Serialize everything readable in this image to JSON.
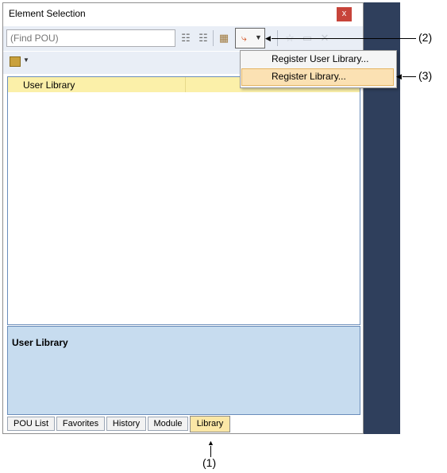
{
  "window": {
    "title": "Element Selection",
    "close_label": "x"
  },
  "search": {
    "placeholder": "(Find POU)"
  },
  "toolbar": {
    "find_next_icon": "binoculars-icon",
    "find_prev_icon": "binoculars-icon",
    "register_icon": "register-library-icon"
  },
  "menu": {
    "items": [
      "Register User Library...",
      "Register Library..."
    ]
  },
  "list": {
    "rows": [
      "User Library"
    ]
  },
  "description": {
    "title": "User Library"
  },
  "tabs": [
    "POU List",
    "Favorites",
    "History",
    "Module",
    "Library"
  ],
  "callouts": {
    "c1": "(1)",
    "c2": "(2)",
    "c3": "(3)"
  },
  "colors": {
    "selected_row": "#fbf0a9",
    "desc_bg": "#c7dcef",
    "active_tab": "#fbe7a6",
    "menu_highlight": "#fbe1b3"
  }
}
